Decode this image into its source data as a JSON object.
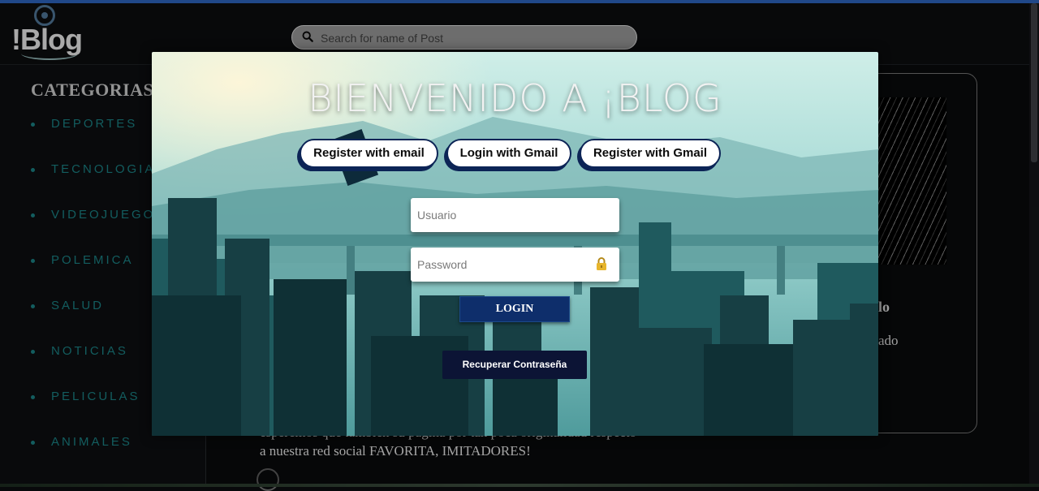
{
  "header": {
    "logo_text": "!Blog",
    "search": {
      "placeholder": "Search for name of Post",
      "icon": "search-icon"
    }
  },
  "sidebar": {
    "title": "CATEGORIAS",
    "items": [
      {
        "label": "DEPORTES"
      },
      {
        "label": "TECNOLOGIA"
      },
      {
        "label": "VIDEOJUEGOS"
      },
      {
        "label": "POLEMICA"
      },
      {
        "label": "SALUD"
      },
      {
        "label": "NOTICIAS"
      },
      {
        "label": "PELICULAS"
      },
      {
        "label": "ANIMALES"
      }
    ]
  },
  "right_card": {
    "title_fragment": "lo",
    "subtitle_fragment": "ado"
  },
  "post": {
    "line1": "esperemos que tambien su pagina por tan poca originalidad respecto",
    "line2": "a nuestra red social FAVORITA, IMITADORES!"
  },
  "modal": {
    "welcome": "BIENVENIDO A ¡BLOG",
    "buttons": {
      "register_email": "Register with email",
      "login_gmail": "Login with Gmail",
      "register_gmail": "Register with Gmail"
    },
    "username": {
      "placeholder": "Usuario",
      "value": ""
    },
    "password": {
      "placeholder": "Password",
      "value": "",
      "icon": "lock-icon"
    },
    "login_label": "LOGIN",
    "recover_label": "Recuperar Contraseña"
  },
  "colors": {
    "accent_nav": "#19787a",
    "button_dark": "#0c2456",
    "login_bg": "#0e2e6b",
    "recover_bg": "#0c1435",
    "top_stripe": "#2a5db0"
  }
}
